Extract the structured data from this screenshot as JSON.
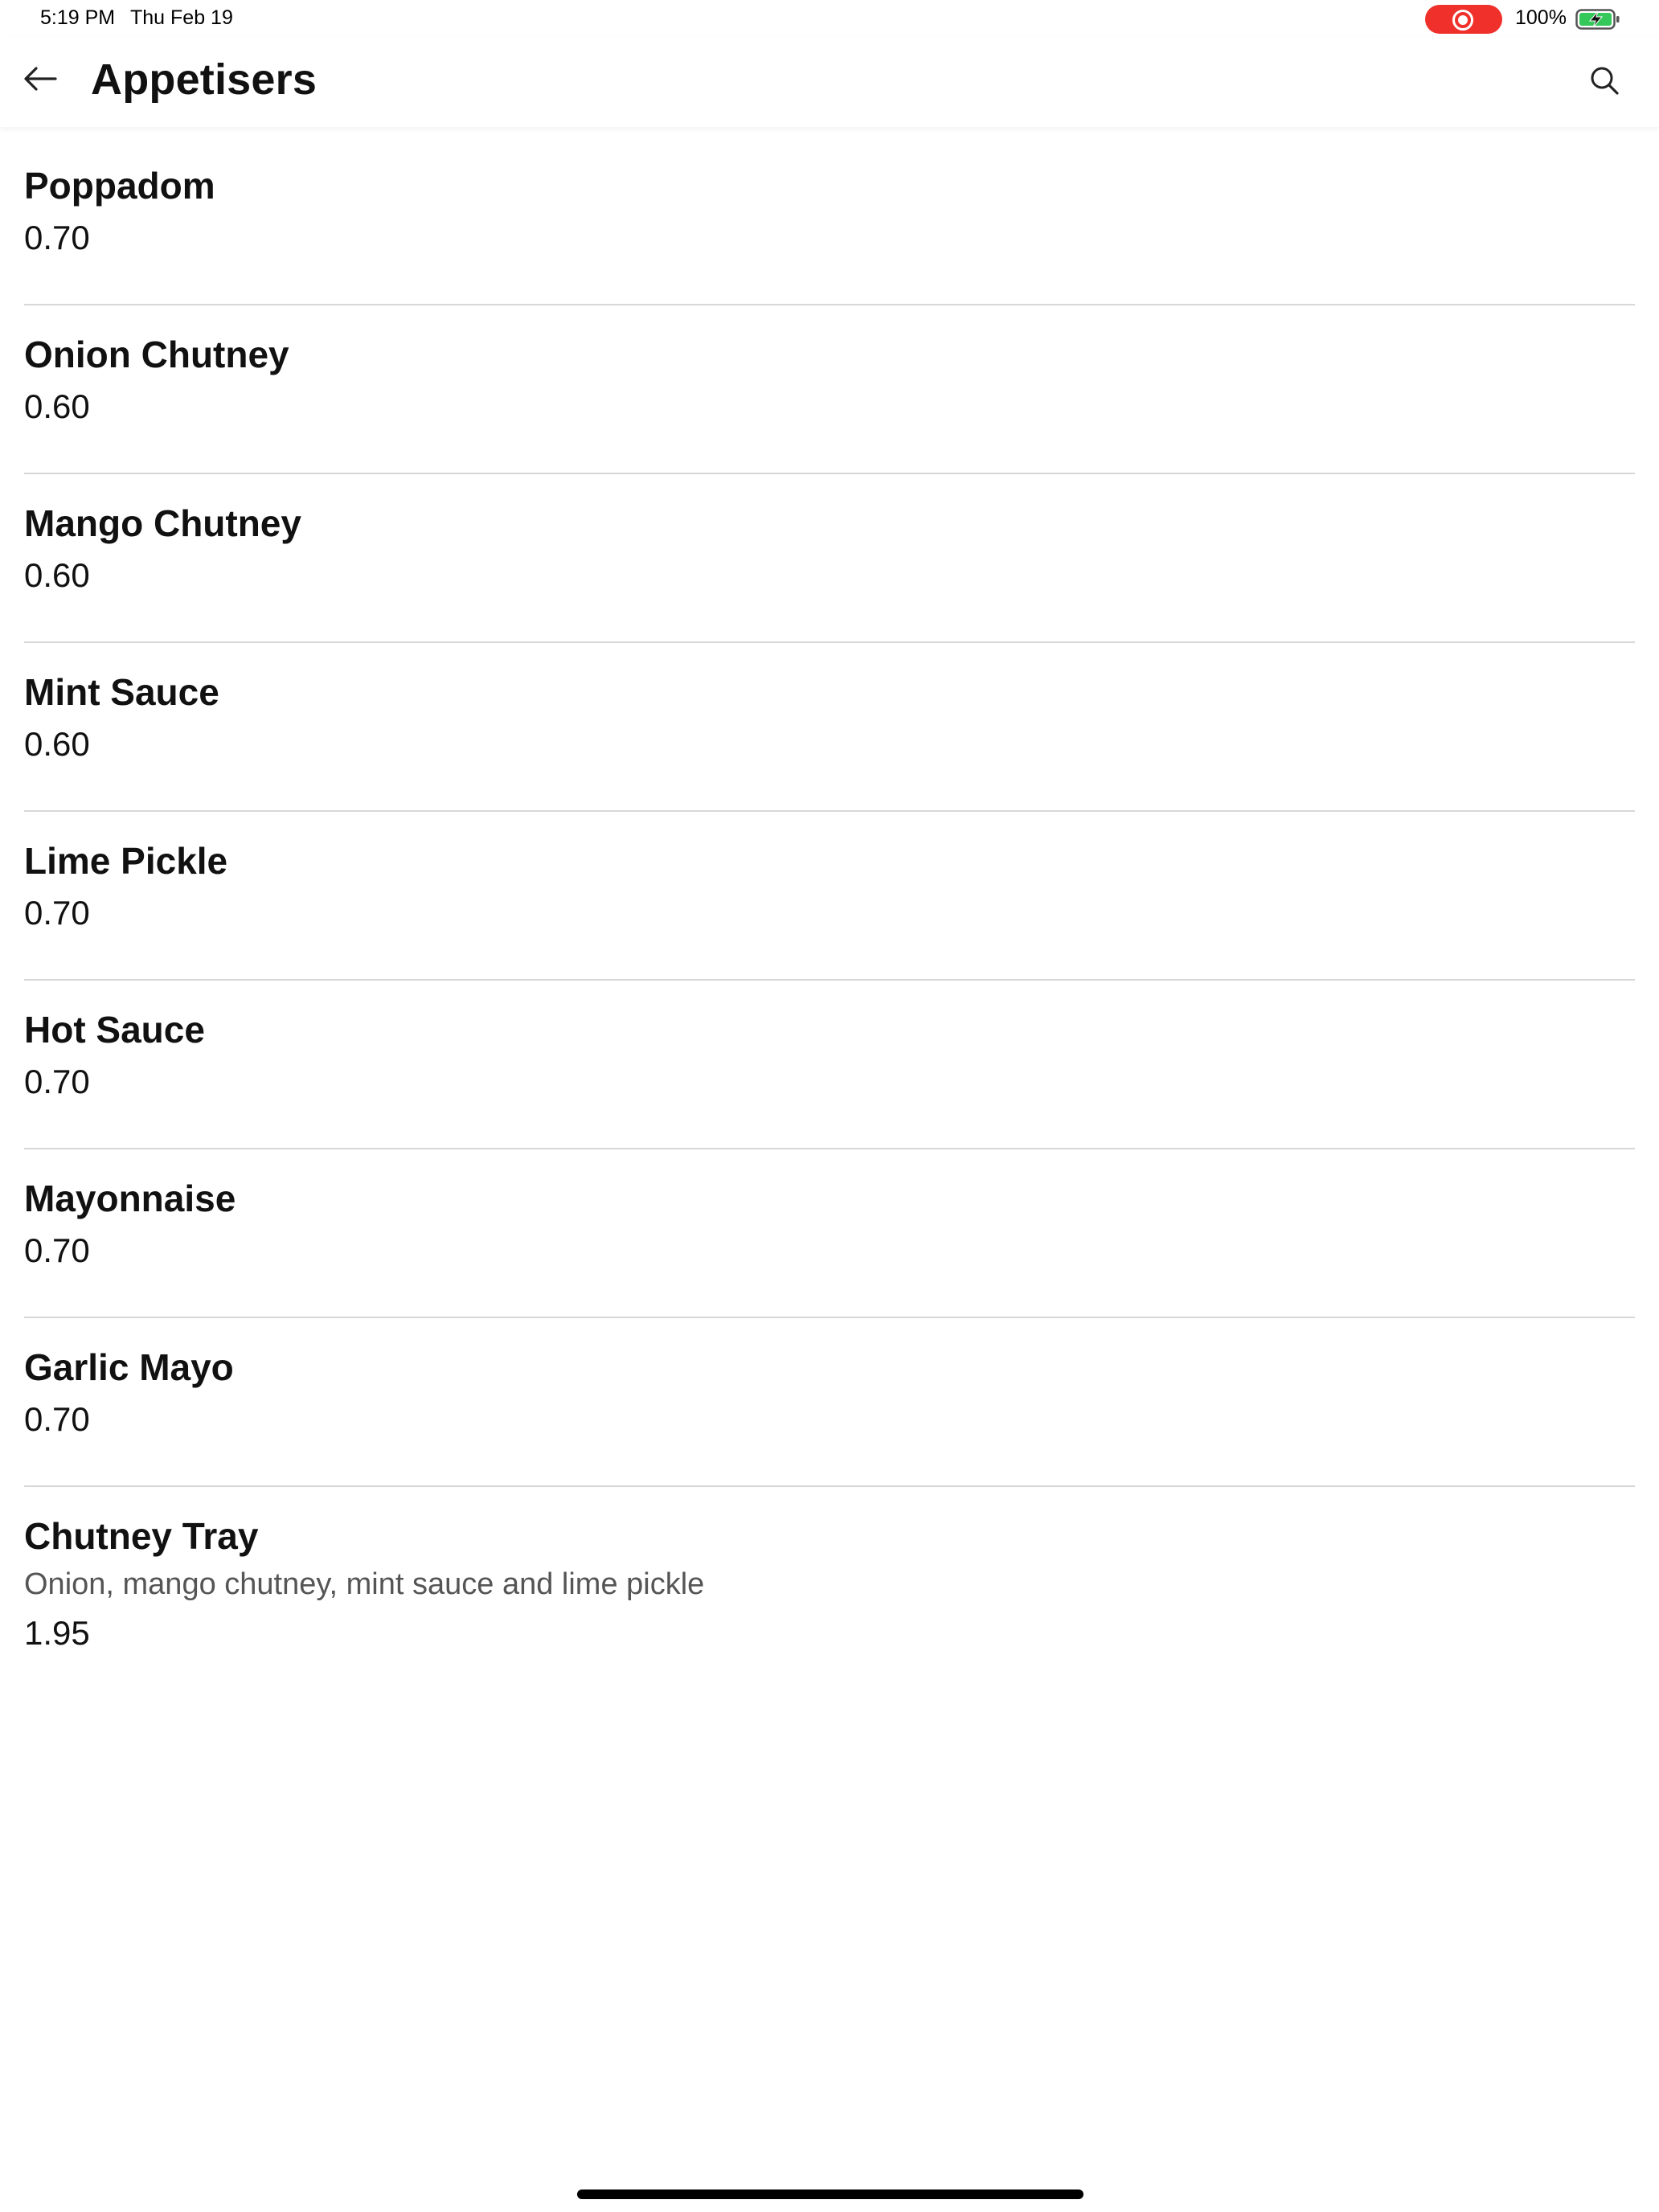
{
  "status_bar": {
    "time": "5:19 PM",
    "date": "Thu Feb 19",
    "battery_percent": "100%",
    "recording_color": "#f0302b",
    "battery_color": "#34c759"
  },
  "header": {
    "title": "Appetisers",
    "back_icon": "arrow-left-icon",
    "search_icon": "search-icon"
  },
  "menu": {
    "items": [
      {
        "name": "Poppadom",
        "price": "0.70"
      },
      {
        "name": "Onion Chutney",
        "price": "0.60"
      },
      {
        "name": "Mango Chutney",
        "price": "0.60"
      },
      {
        "name": "Mint Sauce",
        "price": "0.60"
      },
      {
        "name": "Lime Pickle",
        "price": "0.70"
      },
      {
        "name": "Hot Sauce",
        "price": "0.70"
      },
      {
        "name": "Mayonnaise",
        "price": "0.70"
      },
      {
        "name": "Garlic Mayo",
        "price": "0.70"
      },
      {
        "name": "Chutney Tray",
        "description": "Onion, mango chutney, mint sauce and lime pickle",
        "price": "1.95"
      }
    ]
  }
}
